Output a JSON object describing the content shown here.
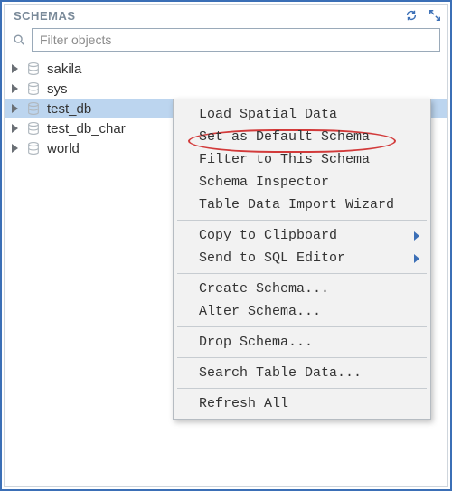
{
  "panel": {
    "title": "SCHEMAS"
  },
  "search": {
    "placeholder": "Filter objects",
    "value": ""
  },
  "tree": {
    "items": [
      {
        "label": "sakila",
        "selected": false
      },
      {
        "label": "sys",
        "selected": false
      },
      {
        "label": "test_db",
        "selected": true
      },
      {
        "label": "test_db_char",
        "selected": false
      },
      {
        "label": "world",
        "selected": false
      }
    ]
  },
  "context_menu": {
    "groups": [
      [
        {
          "label": "Load Spatial Data",
          "submenu": false,
          "highlighted": false
        },
        {
          "label": "Set as Default Schema",
          "submenu": false,
          "highlighted": true
        },
        {
          "label": "Filter to This Schema",
          "submenu": false,
          "highlighted": false
        },
        {
          "label": "Schema Inspector",
          "submenu": false,
          "highlighted": false
        },
        {
          "label": "Table Data Import Wizard",
          "submenu": false,
          "highlighted": false
        }
      ],
      [
        {
          "label": "Copy to Clipboard",
          "submenu": true,
          "highlighted": false
        },
        {
          "label": "Send to SQL Editor",
          "submenu": true,
          "highlighted": false
        }
      ],
      [
        {
          "label": "Create Schema...",
          "submenu": false,
          "highlighted": false
        },
        {
          "label": "Alter Schema...",
          "submenu": false,
          "highlighted": false
        }
      ],
      [
        {
          "label": "Drop Schema...",
          "submenu": false,
          "highlighted": false
        }
      ],
      [
        {
          "label": "Search Table Data...",
          "submenu": false,
          "highlighted": false
        }
      ],
      [
        {
          "label": "Refresh All",
          "submenu": false,
          "highlighted": false
        }
      ]
    ]
  }
}
